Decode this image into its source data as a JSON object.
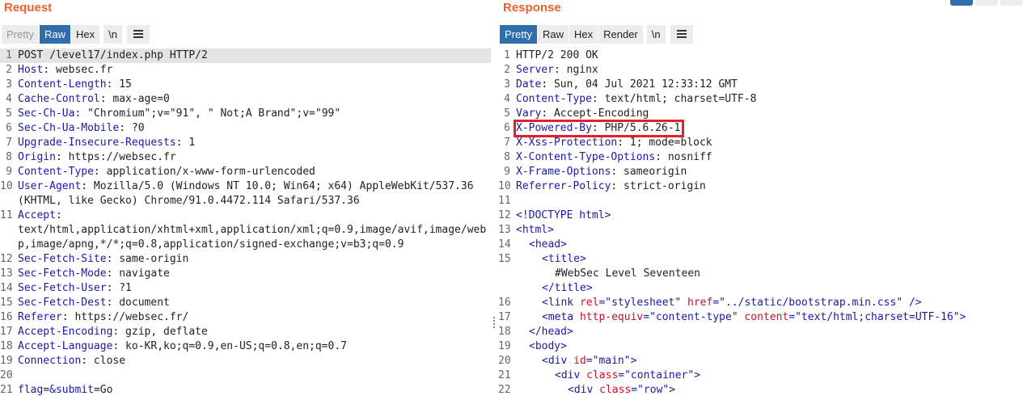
{
  "request": {
    "title": "Request",
    "tabs": [
      {
        "label": "Pretty",
        "state": "disabled"
      },
      {
        "label": "Raw",
        "state": "selected"
      },
      {
        "label": "Hex",
        "state": "normal"
      },
      {
        "label": "\\n",
        "state": "normal"
      }
    ],
    "lines": [
      {
        "n": "1",
        "key": "",
        "val": "POST /level17/index.php HTTP/2"
      },
      {
        "n": "2",
        "key": "Host",
        "val": ": websec.fr"
      },
      {
        "n": "3",
        "key": "Content-Length",
        "val": ": 15"
      },
      {
        "n": "4",
        "key": "Cache-Control",
        "val": ": max-age=0"
      },
      {
        "n": "5",
        "key": "Sec-Ch-Ua",
        "val": ": \"Chromium\";v=\"91\", \" Not;A Brand\";v=\"99\""
      },
      {
        "n": "6",
        "key": "Sec-Ch-Ua-Mobile",
        "val": ": ?0"
      },
      {
        "n": "7",
        "key": "Upgrade-Insecure-Requests",
        "val": ": 1"
      },
      {
        "n": "8",
        "key": "Origin",
        "val": ": https://websec.fr"
      },
      {
        "n": "9",
        "key": "Content-Type",
        "val": ": application/x-www-form-urlencoded"
      },
      {
        "n": "10",
        "key": "User-Agent",
        "val": ": Mozilla/5.0 (Windows NT 10.0; Win64; x64) AppleWebKit/537.36 (KHTML, like Gecko) Chrome/91.0.4472.114 Safari/537.36"
      },
      {
        "n": "11",
        "key": "Accept",
        "val": ":\ntext/html,application/xhtml+xml,application/xml;q=0.9,image/avif,image/webp,image/apng,*/*;q=0.8,application/signed-exchange;v=b3;q=0.9"
      },
      {
        "n": "12",
        "key": "Sec-Fetch-Site",
        "val": ": same-origin"
      },
      {
        "n": "13",
        "key": "Sec-Fetch-Mode",
        "val": ": navigate"
      },
      {
        "n": "14",
        "key": "Sec-Fetch-User",
        "val": ": ?1"
      },
      {
        "n": "15",
        "key": "Sec-Fetch-Dest",
        "val": ": document"
      },
      {
        "n": "16",
        "key": "Referer",
        "val": ": https://websec.fr/"
      },
      {
        "n": "17",
        "key": "Accept-Encoding",
        "val": ": gzip, deflate"
      },
      {
        "n": "18",
        "key": "Accept-Language",
        "val": ": ko-KR,ko;q=0.9,en-US;q=0.8,en;q=0.7"
      },
      {
        "n": "19",
        "key": "Connection",
        "val": ": close"
      },
      {
        "n": "20",
        "key": "",
        "val": ""
      },
      {
        "n": "21",
        "key": "",
        "val": "",
        "body": [
          [
            "flag",
            "="
          ],
          [
            "&submit",
            "=Go"
          ]
        ]
      }
    ]
  },
  "response": {
    "title": "Response",
    "tabs": [
      {
        "label": "Pretty",
        "state": "selected"
      },
      {
        "label": "Raw",
        "state": "normal"
      },
      {
        "label": "Hex",
        "state": "normal"
      },
      {
        "label": "Render",
        "state": "normal"
      },
      {
        "label": "\\n",
        "state": "normal"
      }
    ],
    "headers": [
      {
        "n": "1",
        "key": "",
        "val": "HTTP/2 200 OK"
      },
      {
        "n": "2",
        "key": "Server",
        "val": ": nginx"
      },
      {
        "n": "3",
        "key": "Date",
        "val": ": Sun, 04 Jul 2021 12:33:12 GMT"
      },
      {
        "n": "4",
        "key": "Content-Type",
        "val": ": text/html; charset=UTF-8"
      },
      {
        "n": "5",
        "key": "Vary",
        "val": ": Accept-Encoding"
      },
      {
        "n": "6",
        "key": "X-Powered-By",
        "val": ": PHP/5.6.26-1",
        "highlight": true
      },
      {
        "n": "7",
        "key": "X-Xss-Protection",
        "val": ": 1; mode=block"
      },
      {
        "n": "8",
        "key": "X-Content-Type-Options",
        "val": ": nosniff"
      },
      {
        "n": "9",
        "key": "X-Frame-Options",
        "val": ": sameorigin"
      },
      {
        "n": "10",
        "key": "Referrer-Policy",
        "val": ": strict-origin"
      },
      {
        "n": "11",
        "key": "",
        "val": ""
      }
    ],
    "body": [
      {
        "n": "12",
        "indent": 0,
        "parts": [
          [
            "tag",
            "<!DOCTYPE html>"
          ]
        ]
      },
      {
        "n": "13",
        "indent": 0,
        "parts": [
          [
            "tag",
            "<html>"
          ]
        ]
      },
      {
        "n": "14",
        "indent": 1,
        "parts": [
          [
            "tag",
            "<head>"
          ]
        ]
      },
      {
        "n": "15",
        "indent": 2,
        "parts": [
          [
            "tag",
            "<title>"
          ]
        ]
      },
      {
        "n": "",
        "indent": 3,
        "parts": [
          [
            "txt",
            "#WebSec Level Seventeen"
          ]
        ]
      },
      {
        "n": "",
        "indent": 2,
        "parts": [
          [
            "tag",
            "</title>"
          ]
        ]
      },
      {
        "n": "16",
        "indent": 2,
        "parts": [
          [
            "tag",
            "<link "
          ],
          [
            "atr",
            "rel"
          ],
          [
            "tag",
            "="
          ],
          [
            "str",
            "\"stylesheet\""
          ],
          [
            "tag",
            " "
          ],
          [
            "atr",
            "href"
          ],
          [
            "tag",
            "="
          ],
          [
            "str",
            "\"../static/bootstrap.min.css\""
          ],
          [
            "tag",
            " />"
          ]
        ]
      },
      {
        "n": "17",
        "indent": 2,
        "parts": [
          [
            "tag",
            "<meta "
          ],
          [
            "atr",
            "http-equiv"
          ],
          [
            "tag",
            "="
          ],
          [
            "str",
            "\"content-type\""
          ],
          [
            "tag",
            " "
          ],
          [
            "atr",
            "content"
          ],
          [
            "tag",
            "="
          ],
          [
            "str",
            "\"text/html;charset=UTF-16\""
          ],
          [
            "tag",
            ">"
          ]
        ]
      },
      {
        "n": "18",
        "indent": 1,
        "parts": [
          [
            "tag",
            "</head>"
          ]
        ]
      },
      {
        "n": "19",
        "indent": 1,
        "parts": [
          [
            "tag",
            "<body>"
          ]
        ]
      },
      {
        "n": "20",
        "indent": 2,
        "parts": [
          [
            "tag",
            "<div "
          ],
          [
            "atr",
            "id"
          ],
          [
            "tag",
            "="
          ],
          [
            "str",
            "\"main\""
          ],
          [
            "tag",
            ">"
          ]
        ]
      },
      {
        "n": "21",
        "indent": 3,
        "parts": [
          [
            "tag",
            "<div "
          ],
          [
            "atr",
            "class"
          ],
          [
            "tag",
            "="
          ],
          [
            "str",
            "\"container\""
          ],
          [
            "tag",
            ">"
          ]
        ]
      },
      {
        "n": "22",
        "indent": 4,
        "parts": [
          [
            "tag",
            "<div "
          ],
          [
            "atr",
            "class"
          ],
          [
            "tag",
            "="
          ],
          [
            "str",
            "\"row\""
          ],
          [
            "tag",
            ">"
          ]
        ]
      }
    ]
  },
  "colors": {
    "accent": "#e8622c",
    "selected_tab": "#2f6eaa",
    "header_key": "#1a1aa6",
    "attr": "#c8102e",
    "highlight_box": "#e0202a"
  }
}
